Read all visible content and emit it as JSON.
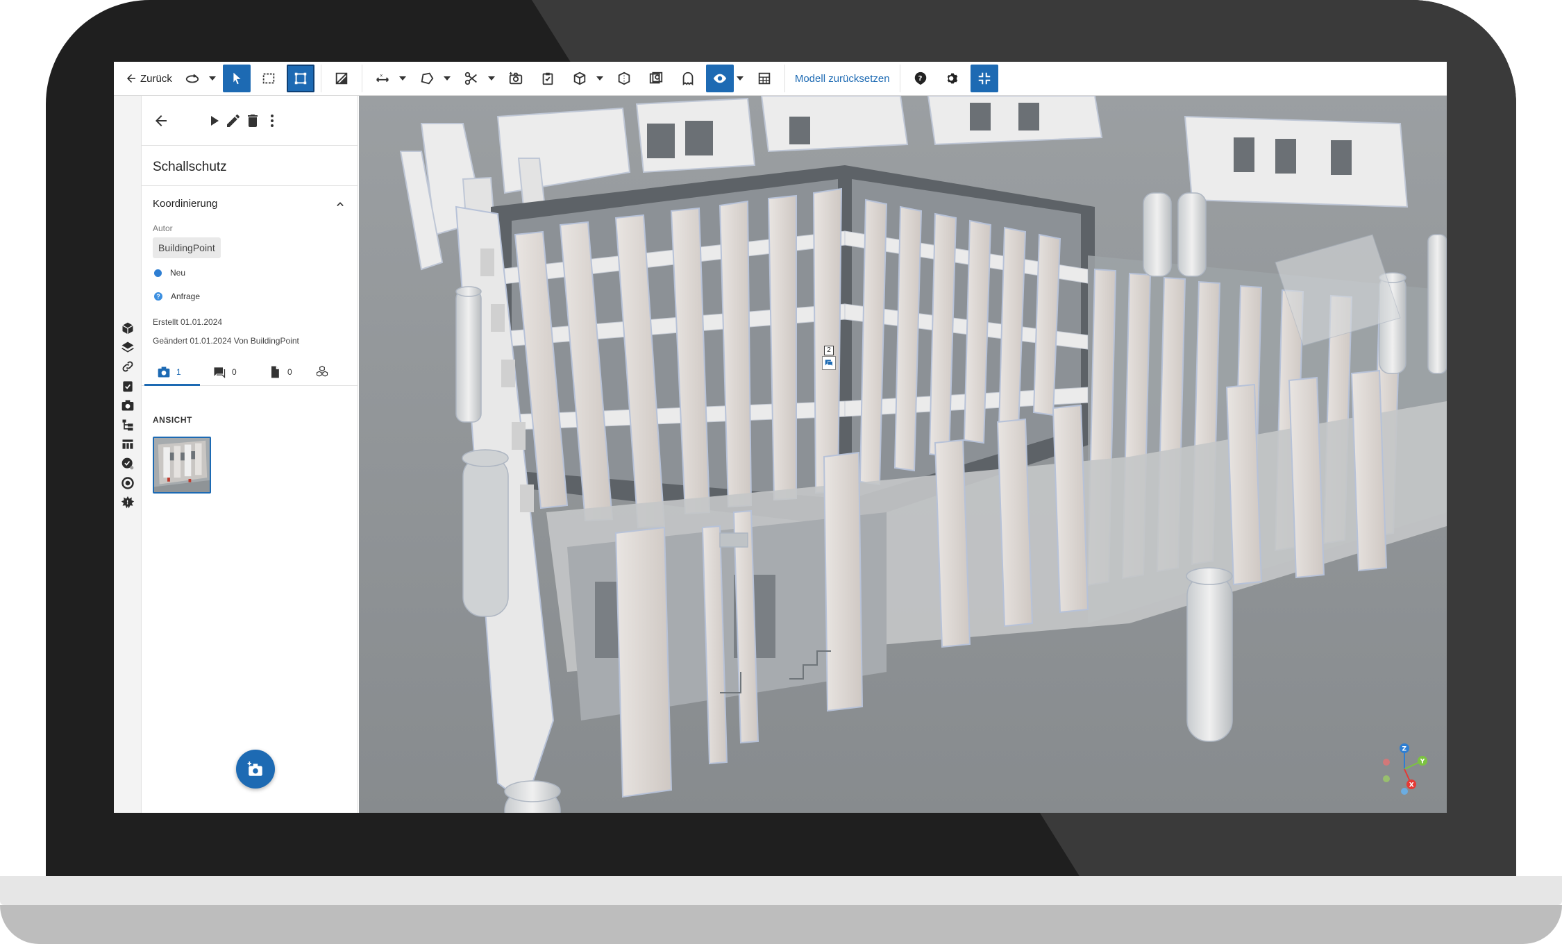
{
  "toolbar": {
    "back_label": "Zurück",
    "reset_model_label": "Modell zurücksetzen"
  },
  "panel": {
    "title": "Schallschutz",
    "section": "Koordinierung",
    "author_label": "Autor",
    "author_value": "BuildingPoint",
    "status": "Neu",
    "type": "Anfrage",
    "created": "Erstellt 01.01.2024",
    "modified": "Geändert 01.01.2024 Von BuildingPoint",
    "tabs": [
      {
        "icon": "camera-icon",
        "count": "1"
      },
      {
        "icon": "comment-icon",
        "count": "0"
      },
      {
        "icon": "document-icon",
        "count": "0"
      },
      {
        "icon": "cubes-icon",
        "count": ""
      }
    ],
    "view_label": "ANSICHT"
  },
  "viewport": {
    "marker_count": "2",
    "axes": {
      "x": "X",
      "y": "Y",
      "z": "Z"
    }
  },
  "colors": {
    "accent": "#1d6ab3",
    "status_new": "#2e7ed2",
    "axis_x": "#e53935",
    "axis_y": "#7cc242",
    "axis_z": "#2e7ed2"
  }
}
